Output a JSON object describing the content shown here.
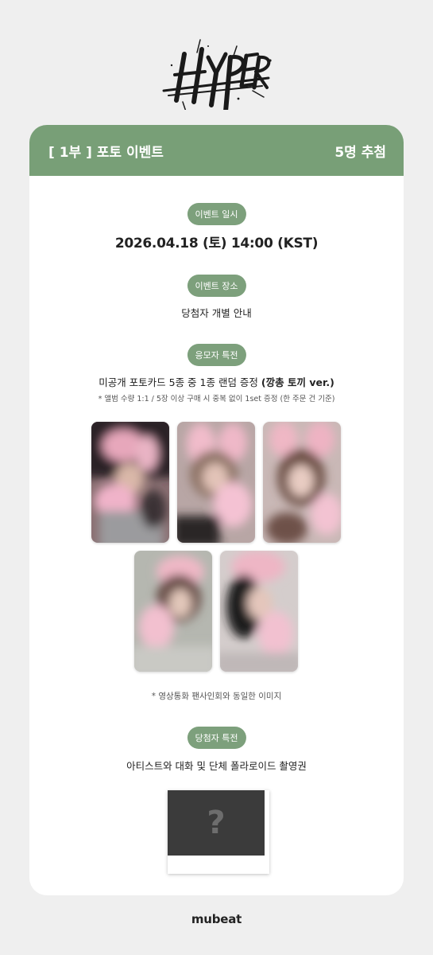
{
  "header": {
    "title": "[ 1부 ] 포토 이벤트",
    "winners": "5명 추첨"
  },
  "date_section": {
    "label": "이벤트 일시",
    "value": "2026.04.18 (토) 14:00 (KST)"
  },
  "place_section": {
    "label": "이벤트 장소",
    "value": "당첨자 개별 안내"
  },
  "applicant_section": {
    "label": "응모자 특전",
    "description_main": "미공개 포토카드 5종 중 1종 랜덤 증정 ",
    "description_bold": "(깡총 토끼 ver.)",
    "note": "* 앨범 수량 1:1 / 5장 이상 구매 시 중복 없이 1set 증정 (한 주문 건 기준)",
    "photo_note": "*  영상통화 팬사인회와 동일한 이미지"
  },
  "winner_section": {
    "label": "당첨자 특전",
    "value": "아티스트와 대화 및 단체 폴라로이드 촬영권",
    "placeholder_symbol": "?"
  },
  "photocards": [
    {
      "name": "photocard-1"
    },
    {
      "name": "photocard-2"
    },
    {
      "name": "photocard-3"
    },
    {
      "name": "photocard-4"
    },
    {
      "name": "photocard-5"
    }
  ],
  "footer": {
    "brand": "mubeat"
  },
  "colors": {
    "accent": "#789f77",
    "pill": "#7da07c",
    "background": "#efefef"
  }
}
